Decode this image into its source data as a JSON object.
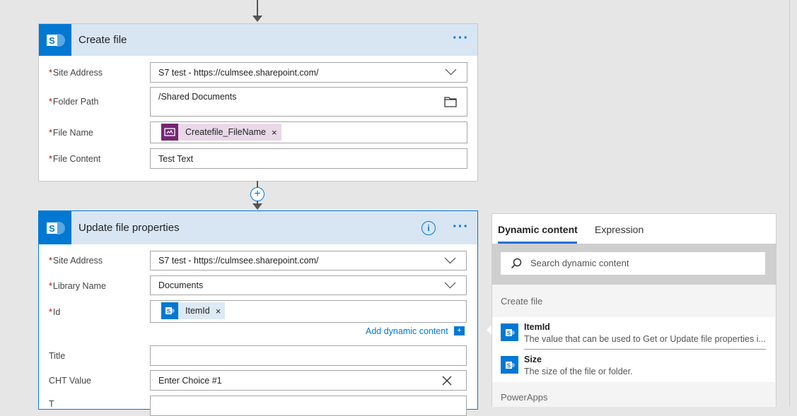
{
  "create_card": {
    "title": "Create file",
    "more": "···",
    "fields": [
      {
        "label": "Site Address",
        "value": "S7 test - https://culmsee.sharepoint.com/"
      },
      {
        "label": "Folder Path",
        "value": "/Shared Documents"
      },
      {
        "label": "File Name",
        "token": "Createfile_FileName"
      },
      {
        "label": "File Content",
        "value": "Test Text"
      }
    ]
  },
  "connector": {
    "plus": "+"
  },
  "update_card": {
    "title": "Update file properties",
    "info": "i",
    "more": "···",
    "fields": [
      {
        "label": "Site Address",
        "value": "S7 test - https://culmsee.sharepoint.com/"
      },
      {
        "label": "Library Name",
        "value": "Documents"
      },
      {
        "label": "Id",
        "token": "ItemId"
      },
      {
        "label": "Title",
        "value": ""
      },
      {
        "label": "CHT Value",
        "value": "Enter Choice #1"
      },
      {
        "label": "T",
        "value": ""
      }
    ],
    "add_dynamic": "Add dynamic content",
    "add_dynamic_icon": "+"
  },
  "dynamic_panel": {
    "tabs": [
      "Dynamic content",
      "Expression"
    ],
    "search_placeholder": "Search dynamic content",
    "section_create": "Create file",
    "items": [
      {
        "title": "ItemId",
        "desc": "The value that can be used to Get or Update file properties i..."
      },
      {
        "title": "Size",
        "desc": "The size of the file or folder."
      }
    ],
    "section_powerapps": "PowerApps"
  },
  "token_x": "×",
  "colors": {
    "accent": "#0078d4",
    "header": "#d8e6f3",
    "powerapps": "#742774",
    "token_bg": "#e9d8e8",
    "token_blue_bg": "#dde9f5"
  }
}
